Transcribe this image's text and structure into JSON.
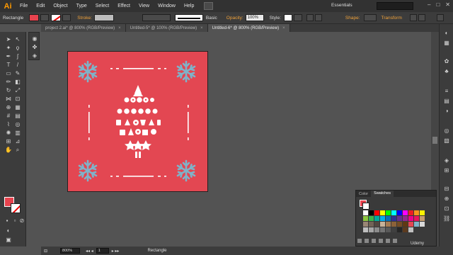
{
  "app": {
    "logo": "Ai",
    "workspace": "Essentials"
  },
  "menu": [
    "File",
    "Edit",
    "Object",
    "Type",
    "Select",
    "Effect",
    "View",
    "Window",
    "Help"
  ],
  "control": {
    "object_type": "Rectangle",
    "stroke_label": "Stroke:",
    "brush_label": "Basic",
    "opacity_label": "Opacity:",
    "opacity_value": "100%",
    "style_label": "Style:",
    "shape_label": "Shape:",
    "transform_label": "Transform"
  },
  "tabs": [
    {
      "label": "project 2.ai* @ 800% (RGB/Preview)",
      "active": false
    },
    {
      "label": "Untitled-5* @ 100% (RGB/Preview)",
      "active": false
    },
    {
      "label": "Untitled-6* @ 800% (RGB/Preview)",
      "active": true
    }
  ],
  "swatches": {
    "tabs": [
      "Color",
      "Swatches"
    ]
  },
  "status": {
    "zoom": "800%",
    "artboard": "1",
    "tool": "Rectangle"
  },
  "watermark": "Udemy",
  "colors": {
    "artboard": "#e34752",
    "snowflake": "#7fb3c9",
    "accent": "#ff9a00"
  }
}
